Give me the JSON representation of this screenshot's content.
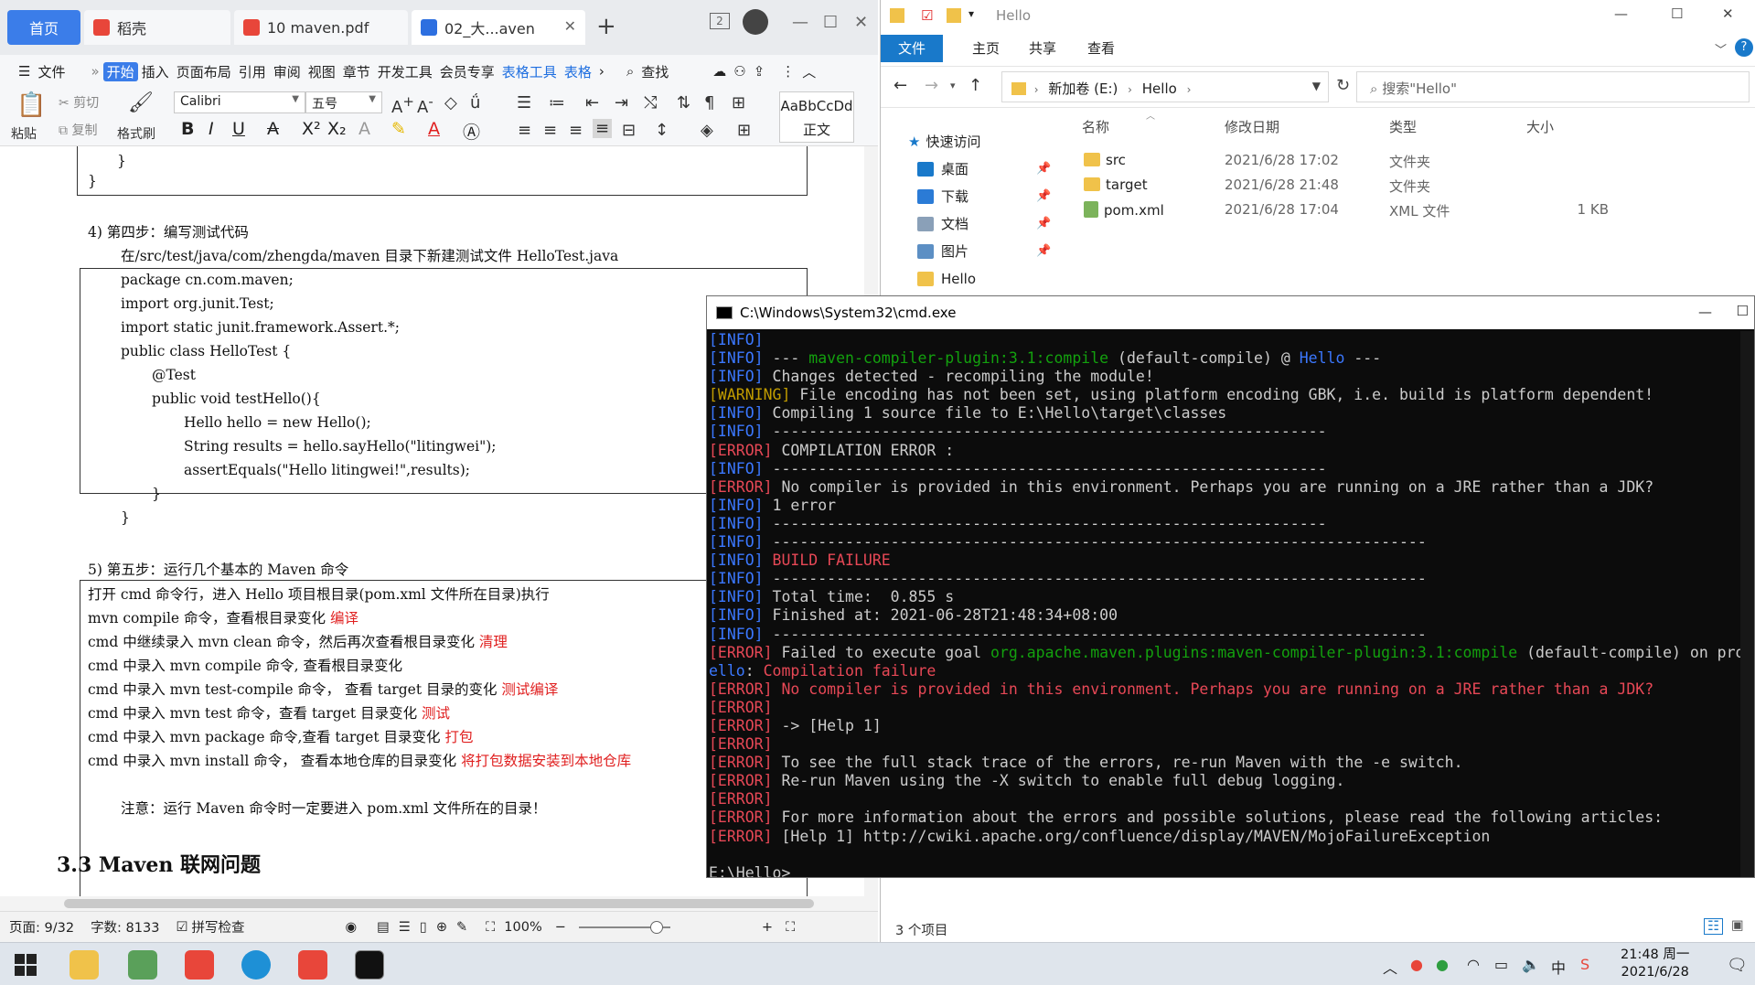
{
  "wps": {
    "tabs": {
      "home": "首页",
      "daoke": "稻壳",
      "pdf": "10 maven.pdf",
      "doc": "02_大...aven"
    },
    "menu": [
      "文件",
      "开始",
      "插入",
      "页面布局",
      "引用",
      "审阅",
      "视图",
      "章节",
      "开发工具",
      "会员专享",
      "表格工具",
      "表格"
    ],
    "menu_search": "查找",
    "ribbon": {
      "paste": "粘贴",
      "cut": "剪切",
      "copy": "复制",
      "format_painter": "格式刷",
      "font_name": "Calibri",
      "font_size": "五号",
      "style_preview": "AaBbCcDd",
      "style_name": "正文"
    },
    "doc_lines": {
      "brace1": "}",
      "brace2": "}",
      "step4": "4)    第四步：编写测试代码",
      "step4_desc": "在/src/test/java/com/zhengda/maven 目录下新建测试文件 HelloTest.java",
      "code": [
        "package cn.com.maven;",
        "import org.junit.Test;",
        "import static junit.framework.Assert.*;",
        "public class HelloTest {",
        "@Test",
        "public void testHello(){",
        "Hello hello = new Hello();",
        "String results = hello.sayHello(\"litingwei\");",
        "assertEquals(\"Hello litingwei!\",results);",
        "}",
        "}"
      ],
      "step5": "5)    第五步：运行几个基本的 Maven 命令",
      "cmd_rows": [
        {
          "text": "打开 cmd 命令行，进入 Hello 项目根目录(pom.xml 文件所在目录)执行",
          "note": ""
        },
        {
          "text": "mvn compile 命令，查看根目录变化",
          "note": "编译"
        },
        {
          "text": "cmd  中继续录入 mvn clean 命令，然后再次查看根目录变化",
          "note": "清理"
        },
        {
          "text": "cmd  中录入  mvn    compile 命令, 查看根目录变化",
          "note": ""
        },
        {
          "text": "cmd  中录入  mvn    test-compile 命令，  查看 target 目录的变化",
          "note": "测试编译"
        },
        {
          "text": "cmd  中录入  mvn    test 命令，查看 target 目录变化",
          "note": "测试"
        },
        {
          "text": "cmd  中录入  mvn    package 命令,查看 target 目录变化",
          "note": "打包"
        },
        {
          "text": "cmd  中录入  mvn    install 命令，  查看本地仓库的目录变化",
          "note": "将打包数据安装到本地仓库"
        }
      ],
      "note": "注意：运行 Maven 命令时一定要进入 pom.xml 文件所在的目录！",
      "heading": "3.3 Maven  联网问题"
    },
    "status": {
      "page": "页面: 9/32",
      "words": "字数: 8133",
      "spell": "拼写检查",
      "zoom": "100%"
    }
  },
  "explorer": {
    "title": "Hello",
    "tabs": [
      "文件",
      "主页",
      "共享",
      "查看"
    ],
    "breadcrumb": [
      "新加卷 (E:)",
      "Hello"
    ],
    "search_placeholder": "搜索\"Hello\"",
    "nav": {
      "quick": "快速访问",
      "items": [
        "桌面",
        "下载",
        "文档",
        "图片",
        "Hello"
      ]
    },
    "columns": [
      "名称",
      "修改日期",
      "类型",
      "大小"
    ],
    "files": [
      {
        "name": "src",
        "date": "2021/6/28 17:02",
        "type": "文件夹",
        "size": ""
      },
      {
        "name": "target",
        "date": "2021/6/28 21:48",
        "type": "文件夹",
        "size": ""
      },
      {
        "name": "pom.xml",
        "date": "2021/6/28 17:04",
        "type": "XML 文件",
        "size": "1 KB"
      }
    ],
    "status": "3 个项目"
  },
  "cmd": {
    "title": "C:\\Windows\\System32\\cmd.exe",
    "lines": [
      [
        {
          "t": "[INFO]",
          "c": "tb"
        }
      ],
      [
        {
          "t": "[INFO]",
          "c": "tb"
        },
        {
          "t": " --- ",
          "c": ""
        },
        {
          "t": "maven-compiler-plugin:3.1:compile",
          "c": "tg"
        },
        {
          "t": " (default-compile) @ ",
          "c": ""
        },
        {
          "t": "Hello",
          "c": "tc"
        },
        {
          "t": " ---",
          "c": ""
        }
      ],
      [
        {
          "t": "[INFO]",
          "c": "tb"
        },
        {
          "t": " Changes detected - recompiling the module!",
          "c": ""
        }
      ],
      [
        {
          "t": "[WARNING]",
          "c": "tw"
        },
        {
          "t": " File encoding has not been set, using platform encoding GBK, i.e. build is platform dependent!",
          "c": ""
        }
      ],
      [
        {
          "t": "[INFO]",
          "c": "tb"
        },
        {
          "t": " Compiling 1 source file to E:\\Hello\\target\\classes",
          "c": ""
        }
      ],
      [
        {
          "t": "[INFO]",
          "c": "tb"
        },
        {
          "t": " -------------------------------------------------------------",
          "c": ""
        }
      ],
      [
        {
          "t": "[ERROR]",
          "c": "te"
        },
        {
          "t": " COMPILATION ERROR :",
          "c": ""
        }
      ],
      [
        {
          "t": "[INFO]",
          "c": "tb"
        },
        {
          "t": " -------------------------------------------------------------",
          "c": ""
        }
      ],
      [
        {
          "t": "[ERROR]",
          "c": "te"
        },
        {
          "t": " No compiler is provided in this environment. Perhaps you are running on a JRE rather than a JDK?",
          "c": ""
        }
      ],
      [
        {
          "t": "[INFO]",
          "c": "tb"
        },
        {
          "t": " 1 error",
          "c": ""
        }
      ],
      [
        {
          "t": "[INFO]",
          "c": "tb"
        },
        {
          "t": " -------------------------------------------------------------",
          "c": ""
        }
      ],
      [
        {
          "t": "[INFO]",
          "c": "tb"
        },
        {
          "t": " ------------------------------------------------------------------------",
          "c": ""
        }
      ],
      [
        {
          "t": "[INFO]",
          "c": "tb"
        },
        {
          "t": " BUILD FAILURE",
          "c": "te"
        }
      ],
      [
        {
          "t": "[INFO]",
          "c": "tb"
        },
        {
          "t": " ------------------------------------------------------------------------",
          "c": ""
        }
      ],
      [
        {
          "t": "[INFO]",
          "c": "tb"
        },
        {
          "t": " Total time:  0.855 s",
          "c": ""
        }
      ],
      [
        {
          "t": "[INFO]",
          "c": "tb"
        },
        {
          "t": " Finished at: 2021-06-28T21:48:34+08:00",
          "c": ""
        }
      ],
      [
        {
          "t": "[INFO]",
          "c": "tb"
        },
        {
          "t": " ------------------------------------------------------------------------",
          "c": ""
        }
      ],
      [
        {
          "t": "[ERROR]",
          "c": "te"
        },
        {
          "t": " Failed to execute goal ",
          "c": ""
        },
        {
          "t": "org.apache.maven.plugins:maven-compiler-plugin:3.1:compile",
          "c": "tg"
        },
        {
          "t": " (default-compile) on proj",
          "c": ""
        }
      ],
      [
        {
          "t": "ello",
          "c": "tc"
        },
        {
          "t": ": ",
          "c": ""
        },
        {
          "t": "Compilation failure",
          "c": "te"
        }
      ],
      [
        {
          "t": "[ERROR]",
          "c": "te"
        },
        {
          "t": " No compiler is provided in this environment. Perhaps you are running on a JRE rather than a JDK?",
          "c": "te"
        }
      ],
      [
        {
          "t": "[ERROR]",
          "c": "te"
        }
      ],
      [
        {
          "t": "[ERROR]",
          "c": "te"
        },
        {
          "t": " -> [Help 1]",
          "c": ""
        }
      ],
      [
        {
          "t": "[ERROR]",
          "c": "te"
        }
      ],
      [
        {
          "t": "[ERROR]",
          "c": "te"
        },
        {
          "t": " To see the full stack trace of the errors, re-run Maven with the -e switch.",
          "c": ""
        }
      ],
      [
        {
          "t": "[ERROR]",
          "c": "te"
        },
        {
          "t": " Re-run Maven using the -X switch to enable full debug logging.",
          "c": ""
        }
      ],
      [
        {
          "t": "[ERROR]",
          "c": "te"
        }
      ],
      [
        {
          "t": "[ERROR]",
          "c": "te"
        },
        {
          "t": " For more information about the errors and possible solutions, please read the following articles:",
          "c": ""
        }
      ],
      [
        {
          "t": "[ERROR]",
          "c": "te"
        },
        {
          "t": " [Help 1] http://cwiki.apache.org/confluence/display/MAVEN/MojoFailureException",
          "c": ""
        }
      ],
      [
        {
          "t": "",
          "c": ""
        }
      ],
      [
        {
          "t": "E:\\Hello>_",
          "c": ""
        }
      ]
    ]
  },
  "taskbar": {
    "ime": "中",
    "time": "21:48 周一",
    "date": "2021/6/28"
  }
}
